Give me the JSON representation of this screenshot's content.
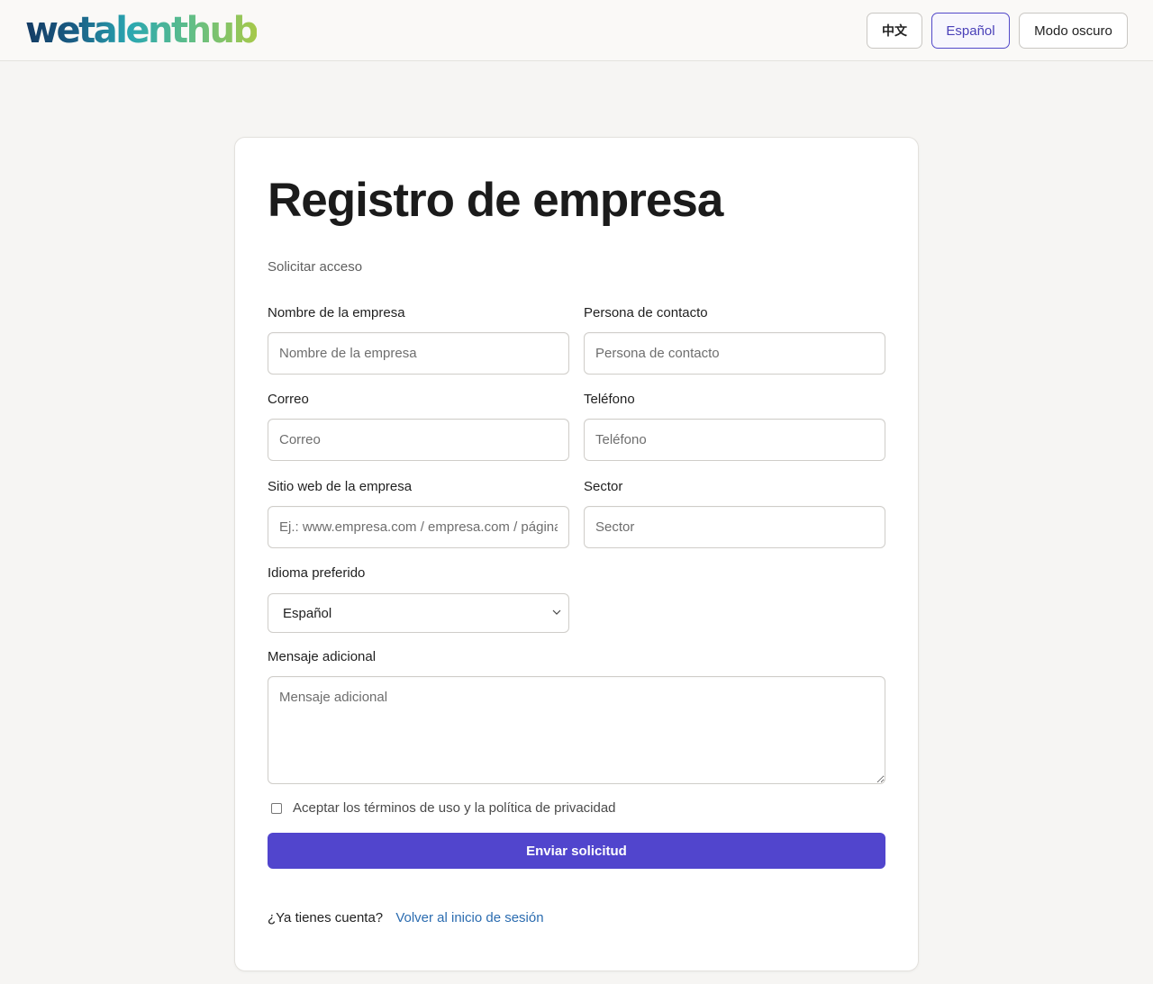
{
  "header": {
    "logo_text": "wetalenthub",
    "lang_zh_label": "中文",
    "lang_es_label": "Español",
    "dark_mode_label": "Modo oscuro"
  },
  "form": {
    "title": "Registro de empresa",
    "subtitle": "Solicitar acceso",
    "company_name": {
      "label": "Nombre de la empresa",
      "placeholder": "Nombre de la empresa",
      "value": ""
    },
    "contact_person": {
      "label": "Persona de contacto",
      "placeholder": "Persona de contacto",
      "value": ""
    },
    "email": {
      "label": "Correo",
      "placeholder": "Correo",
      "value": ""
    },
    "phone": {
      "label": "Teléfono",
      "placeholder": "Teléfono",
      "value": ""
    },
    "website": {
      "label": "Sitio web de la empresa",
      "placeholder": "Ej.: www.empresa.com / empresa.com / página web",
      "value": ""
    },
    "sector": {
      "label": "Sector",
      "placeholder": "Sector",
      "value": ""
    },
    "language": {
      "label": "Idioma preferido",
      "selected": "Español"
    },
    "message": {
      "label": "Mensaje adicional",
      "placeholder": "Mensaje adicional",
      "value": ""
    },
    "terms_label": "Aceptar los términos de uso y la política de privacidad",
    "terms_checked": false,
    "submit_label": "Enviar solicitud",
    "footer_question": "¿Ya tienes cuenta?",
    "footer_link": "Volver al inicio de sesión"
  },
  "colors": {
    "accent": "#5145cd",
    "link": "#2b6cb0",
    "background": "#f6f5f3"
  }
}
